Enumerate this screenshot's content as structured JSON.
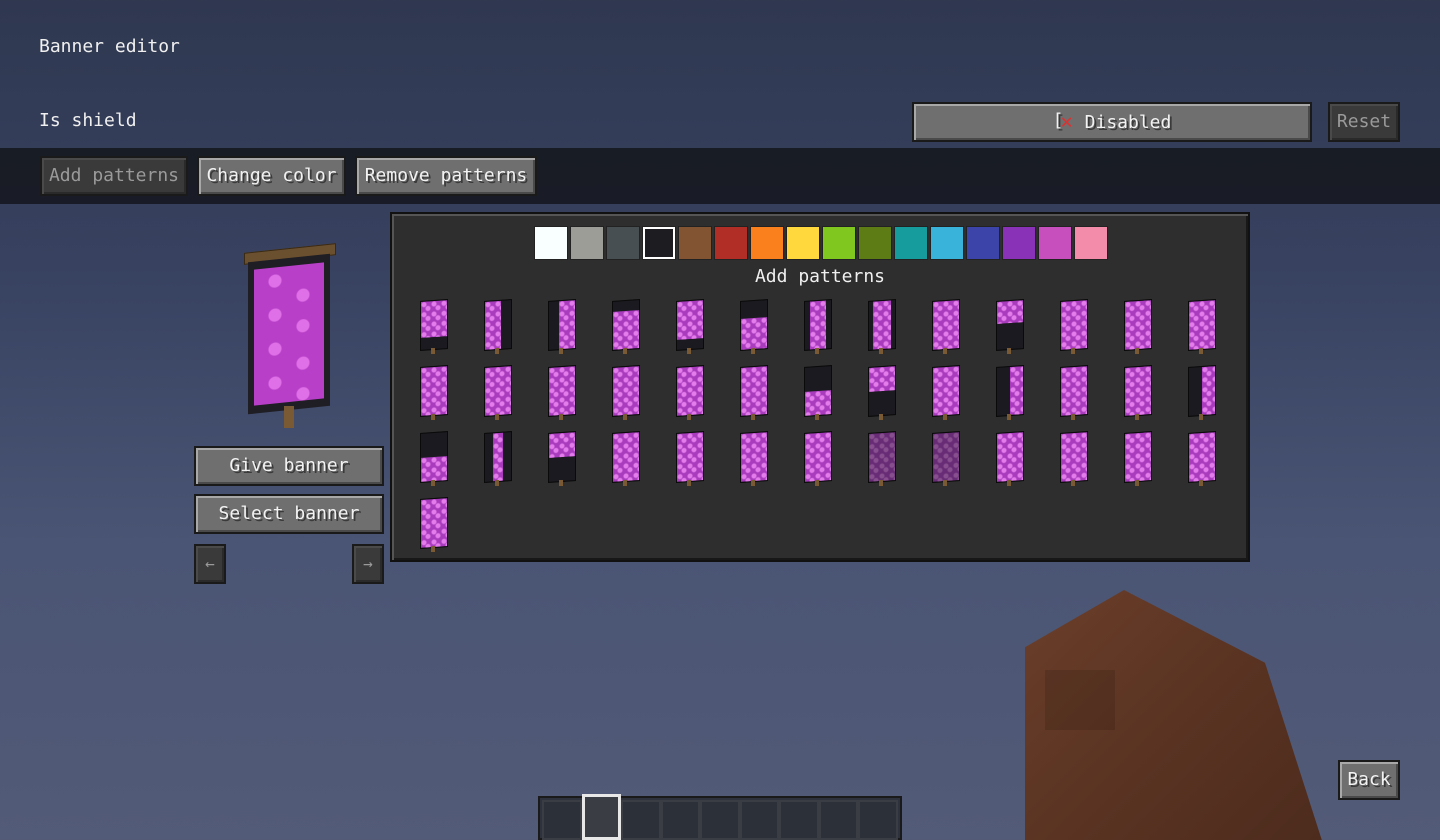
{
  "title": "Banner editor",
  "shield": {
    "label": "Is shield",
    "toggle_state": "Disabled",
    "toggle_icon": "x-icon",
    "reset_label": "Reset"
  },
  "toolbar": {
    "add_label": "Add patterns",
    "color_label": "Change color",
    "remove_label": "Remove patterns"
  },
  "banner": {
    "give_label": "Give banner",
    "select_label": "Select banner",
    "prev_label": "←",
    "next_label": "→"
  },
  "panel": {
    "title": "Add patterns",
    "colors": [
      "#f9fffe",
      "#9d9d97",
      "#474f52",
      "#1d1d21",
      "#835432",
      "#b02e26",
      "#f9801d",
      "#fed83d",
      "#80c71f",
      "#5e7c16",
      "#169c9c",
      "#3ab3da",
      "#3c44aa",
      "#8932b8",
      "#c74ebd",
      "#f38baa"
    ],
    "selected_color_index": 3,
    "pattern_count": 40
  },
  "back_label": "Back",
  "hotbar": {
    "slots": 9,
    "active_slot": 1
  }
}
